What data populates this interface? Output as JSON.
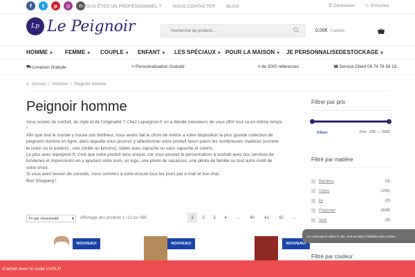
{
  "topbar": {
    "socials": [
      {
        "icon": "facebook-icon",
        "glyph": "f",
        "color": "#3b5998"
      },
      {
        "icon": "twitter-icon",
        "glyph": "t",
        "color": "#1da1f2"
      },
      {
        "icon": "pinterest-icon",
        "glyph": "p",
        "color": "#cb2027"
      },
      {
        "icon": "instagram-icon",
        "glyph": "◎",
        "color": "#a33a8f"
      },
      {
        "icon": "email-icon",
        "glyph": "✉",
        "color": "#555555"
      }
    ],
    "links": [
      "VOUS ÊTES UN PROFESSIONNEL ?",
      "NOUS CONTACTER",
      "BLOG"
    ],
    "login": "Connexion",
    "register": "S'inscrire"
  },
  "header": {
    "logo_text": "Le Peignoir",
    "logo_monogram": "Lp",
    "search_placeholder": "Recherche de produits…",
    "cart_total": "0,00€",
    "cart_count": "0 article"
  },
  "nav": [
    {
      "label": "HOMME",
      "chevron": true
    },
    {
      "label": "FEMME",
      "chevron": true
    },
    {
      "label": "COUPLE",
      "chevron": true
    },
    {
      "label": "ENFANT",
      "chevron": true
    },
    {
      "label": "LES SPÉCIAUX",
      "chevron": true
    },
    {
      "label": "POUR LA MAISON",
      "chevron": true
    },
    {
      "label": "JE PERSONNALISE",
      "chevron": false
    },
    {
      "label": "DESTOCKAGE",
      "chevron": true
    }
  ],
  "perks": [
    {
      "icon": "truck-icon",
      "glyph": "⛟",
      "label": "Livraison Gratuite"
    },
    {
      "icon": "scissors-icon",
      "glyph": "✂",
      "label": "Personnalisation Gratuite"
    },
    {
      "icon": "plus-icon",
      "glyph": "+",
      "label": "de 2000 références"
    },
    {
      "icon": "phone-icon",
      "glyph": "☎",
      "label": "Service Client 09 74 76 58 23"
    }
  ],
  "breadcrumb": {
    "items": [
      "Accueil",
      "Homme",
      "Peignoir homme"
    ],
    "separator": "/"
  },
  "page": {
    "title": "Peignoir homme",
    "intro": [
      "Vous voulez du confort, du style et de l'originalité ? Chez Lepeignoir.fr on a décidé messieurs de vous offrir tout ca en même temps !",
      "Afin que tout le monde y trouve son bonheur, nous avons fait le choix de mettre a votre disposition la plus grande collection de peignoirs homme en ligne, dans laquelle vous pourrez y sélectionner votre produit favori parmi les nombreuses matières (comme le coton ou le polaire) , cols (châle ou kimono), styles avec capuche ou sans capuche et coloris.",
      "Le plus avec lepeignoir.fr, c'est que votre produit sera unique, car vous pouvez le personnaliser à souhait avec nos services de broderies et impressions en y ajoutant votre nom, un logo, une photo de vacances, une photo de famille ou tout autre motif de votre choix.",
      "Si vous avez besoin de conseils, nous sommes à votre écoute tous les jours par e-mail et live chat.",
      "Bon Shopping !"
    ]
  },
  "sortbar": {
    "sort_value": "Tri par nouveauté",
    "result_count": "Affichage des produits 1–12 sur 495",
    "pages": [
      "1",
      "2",
      "3",
      "4",
      "…",
      "40",
      "41",
      "42",
      "→"
    ],
    "current_page": "1"
  },
  "products": {
    "badge": "NOUVEAU!",
    "items": [
      {
        "name": "product-homme-blanc",
        "color": "#e6e6e6"
      },
      {
        "name": "product-plaid-beige",
        "color": "#b58a5b"
      },
      {
        "name": "product-tartan-rouge",
        "color": "#8e2a22"
      }
    ]
  },
  "sidebar": {
    "price_title": "Filtrer par prix",
    "filter_button": "Filtrer",
    "price_range": "Prix : 29€ — 200€",
    "price_min": 29,
    "price_max": 200,
    "material_title": "Filtré par matière",
    "materials": [
      {
        "label": "Bambou",
        "count": "(4)"
      },
      {
        "label": "Coton",
        "count": "(156)"
      },
      {
        "label": "lin",
        "count": "(3)"
      },
      {
        "label": "Polyester",
        "count": "(328)"
      },
      {
        "label": "Soie",
        "count": "(6)"
      }
    ],
    "color_title": "Filtré par couleur"
  },
  "cookie_text": "En continuant à utiliser le site, vous acceptez l'utilisation des cookies.",
  "promo_text": "d'achat avec le code LVGLP",
  "colors": {
    "brand": "#2e2375",
    "badge": "#1a44a8",
    "promo": "#ee4d4f",
    "link": "#1f4fb0"
  }
}
